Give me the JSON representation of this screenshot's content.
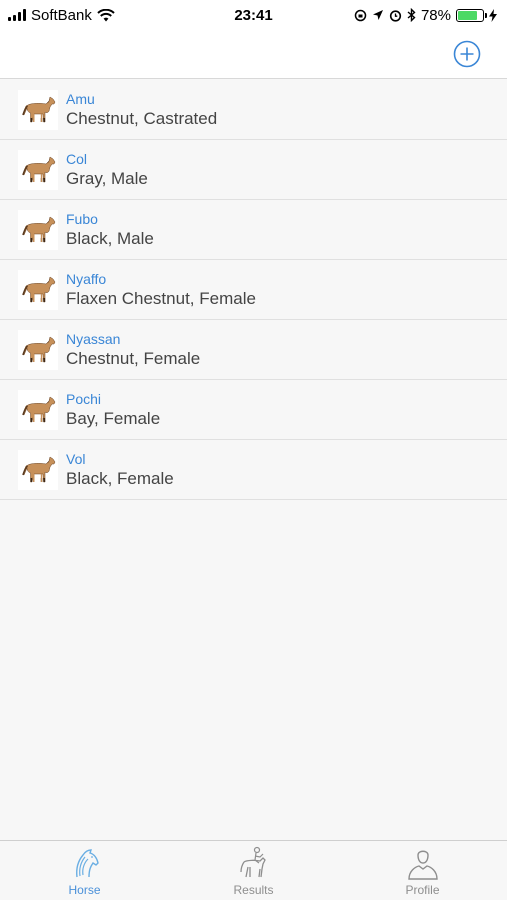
{
  "status_bar": {
    "carrier": "SoftBank",
    "time": "23:41",
    "battery_percent": "78%",
    "battery_level": 0.78
  },
  "nav": {
    "add_icon": "plus-circle-icon",
    "accent_color": "#3a86d6"
  },
  "horses": [
    {
      "name": "Amu",
      "description": "Chestnut, Castrated"
    },
    {
      "name": "Col",
      "description": "Gray, Male"
    },
    {
      "name": "Fubo",
      "description": "Black, Male"
    },
    {
      "name": "Nyaffo",
      "description": "Flaxen Chestnut, Female"
    },
    {
      "name": "Nyassan",
      "description": "Chestnut, Female"
    },
    {
      "name": "Pochi",
      "description": "Bay, Female"
    },
    {
      "name": "Vol",
      "description": "Black, Female"
    }
  ],
  "tabs": [
    {
      "label": "Horse",
      "icon": "horse-head-icon",
      "active": true
    },
    {
      "label": "Results",
      "icon": "rider-icon",
      "active": false
    },
    {
      "label": "Profile",
      "icon": "person-icon",
      "active": false
    }
  ]
}
